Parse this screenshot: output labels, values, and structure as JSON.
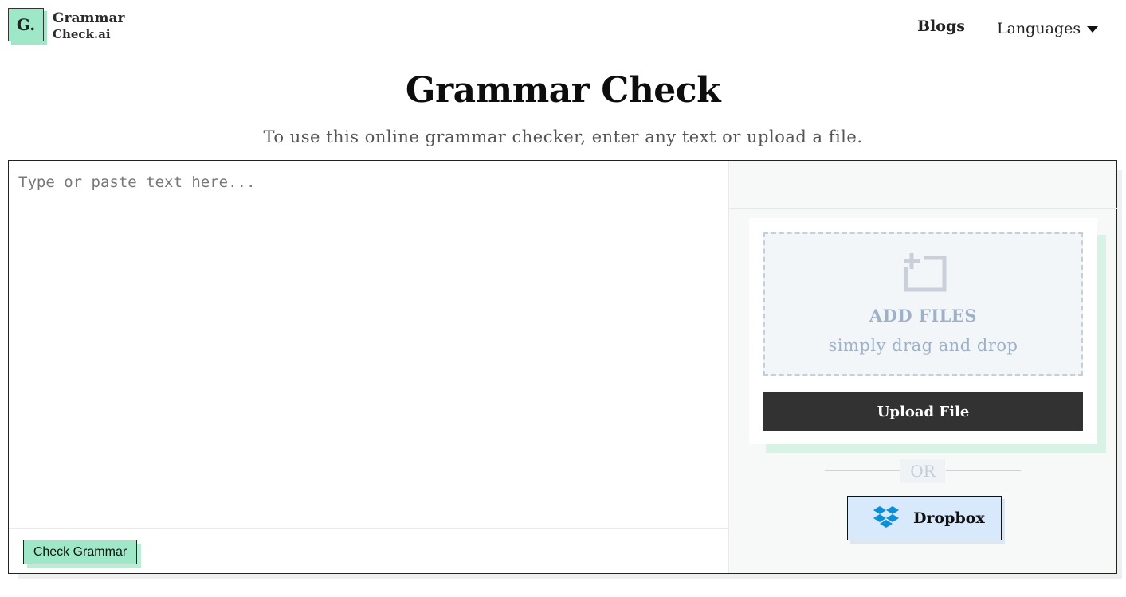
{
  "header": {
    "logo_mark": "G.",
    "logo_line1": "Grammar",
    "logo_line2": "Check.ai",
    "nav_blogs": "Blogs",
    "nav_languages": "Languages"
  },
  "main": {
    "title": "Grammar Check",
    "subtitle": "To use this online grammar checker, enter any text or upload a file."
  },
  "editor": {
    "placeholder": "Type or paste text here...",
    "check_button": "Check Grammar"
  },
  "upload": {
    "add_files": "ADD FILES",
    "drag_drop": "simply drag and drop",
    "upload_button": "Upload File",
    "or_label": "OR",
    "dropbox_label": "Dropbox"
  },
  "icons": {
    "add_file": "add-file-icon",
    "dropbox": "dropbox-icon",
    "languages_caret": "caret-down-icon"
  },
  "colors": {
    "accent_green": "#9ee8c7",
    "dark_button": "#323232",
    "dropbox_blue": "#0061fe",
    "dropzone_text": "#9fb1c6"
  }
}
